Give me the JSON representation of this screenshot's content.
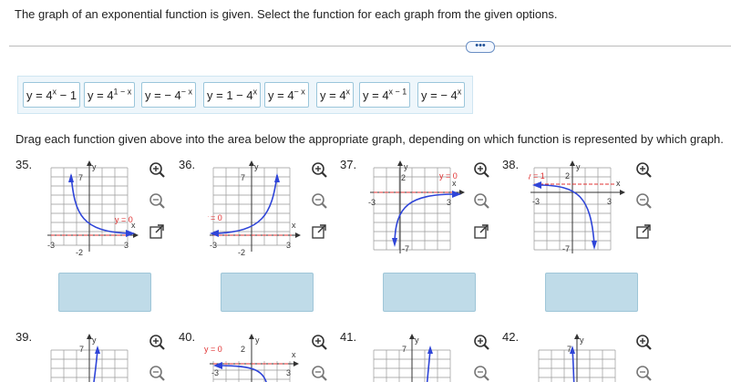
{
  "instruction": "The graph of an exponential function is given. Select the function for each graph from the given options.",
  "more_button": "•••",
  "options": [
    {
      "base": "y = 4",
      "exp": "x",
      "tail": " − 1"
    },
    {
      "base": "y = 4",
      "exp": "1 − x",
      "tail": ""
    },
    {
      "base": "y = − 4",
      "exp": "− x",
      "tail": ""
    },
    {
      "base": "y = 1 − 4",
      "exp": "x",
      "tail": ""
    },
    {
      "base": "y = 4",
      "exp": "− x",
      "tail": ""
    },
    {
      "base": "y = 4",
      "exp": "x",
      "tail": ""
    },
    {
      "base": "y = 4",
      "exp": "x − 1",
      "tail": ""
    },
    {
      "base": "y = − 4",
      "exp": "x",
      "tail": ""
    }
  ],
  "drag_instruction": "Drag each function given above into the area below the appropriate graph, depending on which function is represented by which graph.",
  "graphs": [
    {
      "number": "35.",
      "asymptote": "y = 0",
      "x_label": "x",
      "y_label": "y",
      "ticks": {
        "top": "7",
        "bottom": "-2",
        "left": "-3",
        "right": "3"
      }
    },
    {
      "number": "36.",
      "asymptote": "y = 0",
      "x_label": "x",
      "y_label": "y",
      "ticks": {
        "top": "7",
        "bottom": "-2",
        "left": "-3",
        "right": "3"
      }
    },
    {
      "number": "37.",
      "asymptote": "y = 0",
      "x_label": "x",
      "y_label": "y",
      "ticks": {
        "top": "2",
        "bottom": "-7",
        "left": "-3",
        "right": "3"
      }
    },
    {
      "number": "38.",
      "asymptote": "y = 1",
      "x_label": "x",
      "y_label": "y",
      "ticks": {
        "top": "2",
        "bottom": "-7",
        "left": "-3",
        "right": "3"
      }
    },
    {
      "number": "39.",
      "ticks": {
        "top": "7"
      },
      "y_label": "y"
    },
    {
      "number": "40.",
      "asymptote": "y = 0",
      "x_label": "x",
      "y_label": "y",
      "ticks": {
        "top": "2",
        "left": "-3",
        "right": "3"
      }
    },
    {
      "number": "41.",
      "ticks": {
        "top": "7"
      },
      "y_label": "y"
    },
    {
      "number": "42.",
      "ticks": {
        "top": "7"
      },
      "y_label": "y"
    }
  ],
  "icons": [
    "zoom-in-icon",
    "zoom-out-icon",
    "external-link-icon"
  ],
  "colors": {
    "curve": "#2f45d8",
    "asymptote": "#e03030",
    "drop_zone": "#bfdbe8",
    "grid": "#999999"
  }
}
